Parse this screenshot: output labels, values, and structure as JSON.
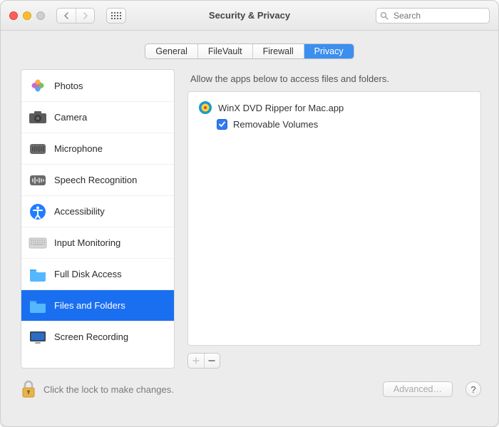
{
  "window": {
    "title": "Security & Privacy"
  },
  "toolbar": {
    "search_placeholder": "Search"
  },
  "tabs": [
    {
      "label": "General",
      "active": false
    },
    {
      "label": "FileVault",
      "active": false
    },
    {
      "label": "Firewall",
      "active": false
    },
    {
      "label": "Privacy",
      "active": true
    }
  ],
  "sidebar": {
    "items": [
      {
        "label": "Photos",
        "icon": "photos-icon"
      },
      {
        "label": "Camera",
        "icon": "camera-icon"
      },
      {
        "label": "Microphone",
        "icon": "microphone-icon"
      },
      {
        "label": "Speech Recognition",
        "icon": "speech-icon"
      },
      {
        "label": "Accessibility",
        "icon": "accessibility-icon"
      },
      {
        "label": "Input Monitoring",
        "icon": "keyboard-icon"
      },
      {
        "label": "Full Disk Access",
        "icon": "folder-icon"
      },
      {
        "label": "Files and Folders",
        "icon": "folder-icon",
        "selected": true
      },
      {
        "label": "Screen Recording",
        "icon": "display-icon"
      }
    ]
  },
  "main": {
    "description": "Allow the apps below to access files and folders.",
    "apps": [
      {
        "name": "WinX DVD Ripper for Mac.app",
        "icon": "winx-icon",
        "permissions": [
          {
            "label": "Removable Volumes",
            "checked": true
          }
        ]
      }
    ],
    "add_enabled": false,
    "remove_enabled": true
  },
  "footer": {
    "lock_text": "Click the lock to make changes.",
    "advanced_label": "Advanced…",
    "help_label": "?"
  }
}
